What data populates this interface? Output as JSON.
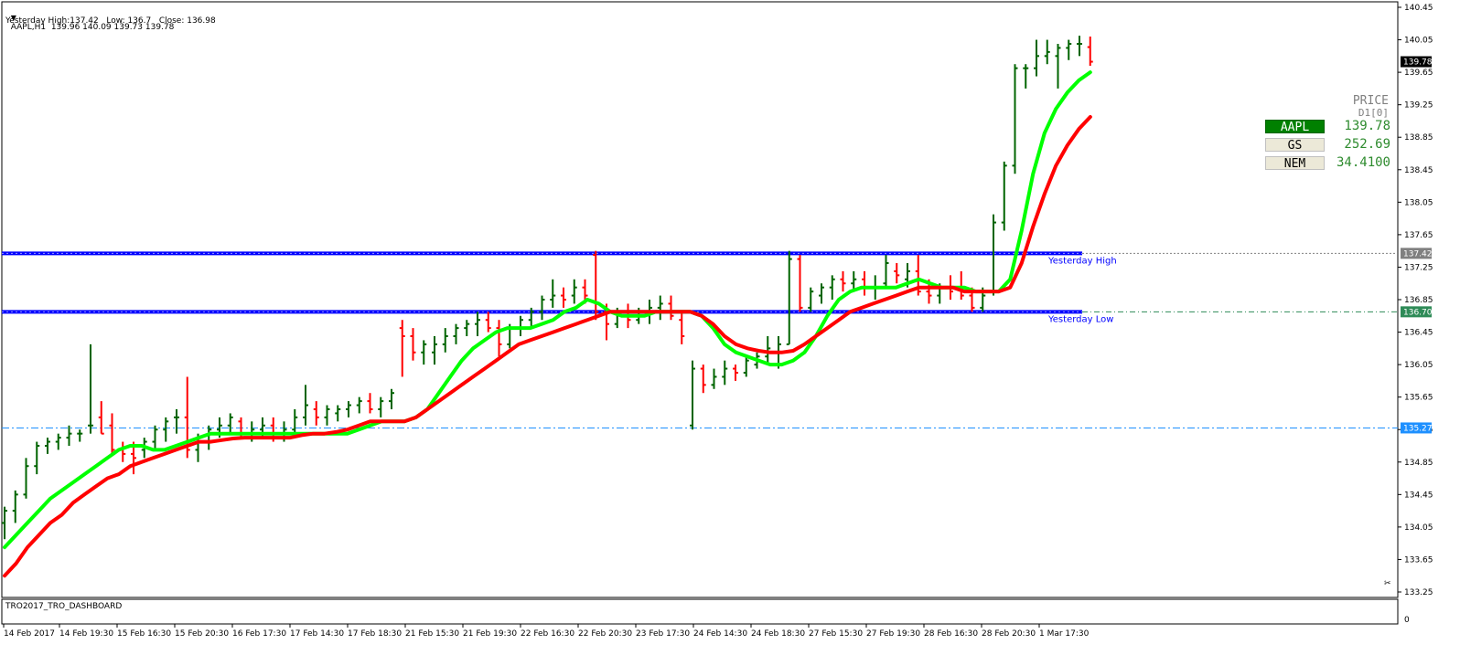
{
  "header": {
    "symbol_line": "AAPL,H1  139.96 140.09 139.73 139.78",
    "yesterday_line": "Yesterday High:137.42   Low: 136.7   Close: 136.98"
  },
  "dashboard": {
    "title": "TRO2017_TRO_DASHBOARD",
    "price_heading": "PRICE",
    "price_sub": "D1[0]",
    "rows": [
      {
        "symbol": "AAPL",
        "value": "139.78",
        "bg": "#008000",
        "fg": "#ffffff",
        "value_color": "#2e8b2e"
      },
      {
        "symbol": "GS",
        "value": "252.69",
        "bg": "#ece9d8",
        "fg": "#000000",
        "value_color": "#2e8b2e"
      },
      {
        "symbol": "NEM",
        "value": "34.4100",
        "bg": "#ece9d8",
        "fg": "#000000",
        "value_color": "#2e8b2e"
      }
    ]
  },
  "colors": {
    "up_bar": "#006400",
    "down_bar": "#ff0000",
    "fast_ma": "#00ff00",
    "slow_ma": "#ff0000",
    "level_line": "#0000ff",
    "close_line": "#1e90ff"
  },
  "chart_data": {
    "type": "line",
    "symbol": "AAPL",
    "timeframe": "H1",
    "ylim": [
      133.25,
      140.45
    ],
    "y_ticks": [
      "140.45",
      "140.05",
      "139.65",
      "139.25",
      "138.85",
      "138.45",
      "138.05",
      "137.65",
      "137.25",
      "136.85",
      "136.45",
      "136.05",
      "135.65",
      "135.25",
      "134.85",
      "134.45",
      "134.05",
      "133.65",
      "133.25"
    ],
    "x_ticks": [
      "14 Feb 2017",
      "14 Feb 19:30",
      "15 Feb 16:30",
      "15 Feb 20:30",
      "16 Feb 17:30",
      "17 Feb 14:30",
      "17 Feb 18:30",
      "21 Feb 15:30",
      "21 Feb 19:30",
      "22 Feb 16:30",
      "22 Feb 20:30",
      "23 Feb 17:30",
      "24 Feb 14:30",
      "24 Feb 18:30",
      "27 Feb 15:30",
      "27 Feb 19:30",
      "28 Feb 16:30",
      "28 Feb 20:30",
      "1 Mar 17:30"
    ],
    "current_price": 139.78,
    "levels": [
      {
        "name": "Yesterday High",
        "value": 137.42
      },
      {
        "name": "Yesterday Low",
        "value": 136.7
      },
      {
        "name": "",
        "value": 135.27
      }
    ],
    "level_tags": [
      "137.42",
      "136.70",
      "135.27",
      "139.78"
    ],
    "bars": [
      [
        134.1,
        134.3,
        133.9,
        134.25
      ],
      [
        134.25,
        134.5,
        134.1,
        134.45
      ],
      [
        134.45,
        134.9,
        134.4,
        134.8
      ],
      [
        134.8,
        135.1,
        134.7,
        135.05
      ],
      [
        135.05,
        135.15,
        134.95,
        135.1
      ],
      [
        135.1,
        135.2,
        135.0,
        135.15
      ],
      [
        135.15,
        135.3,
        135.05,
        135.2
      ],
      [
        135.2,
        135.25,
        135.1,
        135.2
      ],
      [
        135.3,
        136.3,
        135.2,
        135.3
      ],
      [
        135.4,
        135.6,
        135.2,
        135.2
      ],
      [
        135.3,
        135.45,
        134.95,
        135.0
      ],
      [
        135.0,
        135.1,
        134.85,
        134.95
      ],
      [
        134.95,
        135.1,
        134.7,
        134.9
      ],
      [
        135.0,
        135.15,
        134.9,
        135.1
      ],
      [
        135.1,
        135.3,
        135.0,
        135.25
      ],
      [
        135.25,
        135.4,
        135.1,
        135.35
      ],
      [
        135.4,
        135.5,
        135.2,
        135.4
      ],
      [
        135.4,
        135.9,
        134.9,
        135.0
      ],
      [
        135.0,
        135.2,
        134.85,
        135.1
      ],
      [
        135.1,
        135.3,
        135.0,
        135.25
      ],
      [
        135.25,
        135.4,
        135.15,
        135.3
      ],
      [
        135.3,
        135.45,
        135.2,
        135.4
      ],
      [
        135.35,
        135.4,
        135.15,
        135.2
      ],
      [
        135.2,
        135.35,
        135.1,
        135.25
      ],
      [
        135.25,
        135.4,
        135.15,
        135.3
      ],
      [
        135.3,
        135.4,
        135.1,
        135.2
      ],
      [
        135.2,
        135.35,
        135.1,
        135.25
      ],
      [
        135.25,
        135.5,
        135.2,
        135.4
      ],
      [
        135.4,
        135.8,
        135.3,
        135.55
      ],
      [
        135.5,
        135.6,
        135.3,
        135.4
      ],
      [
        135.4,
        135.55,
        135.3,
        135.5
      ],
      [
        135.45,
        135.55,
        135.35,
        135.5
      ],
      [
        135.5,
        135.6,
        135.4,
        135.55
      ],
      [
        135.55,
        135.65,
        135.45,
        135.6
      ],
      [
        135.6,
        135.7,
        135.45,
        135.5
      ],
      [
        135.5,
        135.65,
        135.4,
        135.6
      ],
      [
        135.6,
        135.75,
        135.5,
        135.7
      ],
      [
        136.5,
        136.6,
        135.9,
        136.4
      ],
      [
        136.4,
        136.5,
        136.1,
        136.2
      ],
      [
        136.2,
        136.35,
        136.05,
        136.3
      ],
      [
        136.2,
        136.4,
        136.05,
        136.3
      ],
      [
        136.3,
        136.5,
        136.2,
        136.4
      ],
      [
        136.4,
        136.55,
        136.3,
        136.5
      ],
      [
        136.5,
        136.6,
        136.4,
        136.55
      ],
      [
        136.55,
        136.7,
        136.4,
        136.6
      ],
      [
        136.6,
        136.7,
        136.45,
        136.5
      ],
      [
        136.5,
        136.6,
        136.15,
        136.3
      ],
      [
        136.3,
        136.55,
        136.25,
        136.5
      ],
      [
        136.5,
        136.65,
        136.4,
        136.6
      ],
      [
        136.6,
        136.75,
        136.5,
        136.7
      ],
      [
        136.7,
        136.9,
        136.6,
        136.85
      ],
      [
        136.85,
        137.1,
        136.75,
        136.9
      ],
      [
        136.9,
        137.0,
        136.75,
        136.85
      ],
      [
        136.9,
        137.1,
        136.8,
        137.0
      ],
      [
        137.0,
        137.1,
        136.8,
        136.9
      ],
      [
        137.4,
        137.45,
        136.6,
        136.7
      ],
      [
        136.7,
        136.8,
        136.35,
        136.55
      ],
      [
        136.55,
        136.75,
        136.5,
        136.7
      ],
      [
        136.7,
        136.8,
        136.5,
        136.6
      ],
      [
        136.6,
        136.75,
        136.55,
        136.7
      ],
      [
        136.7,
        136.85,
        136.55,
        136.75
      ],
      [
        136.75,
        136.9,
        136.6,
        136.8
      ],
      [
        136.8,
        136.9,
        136.6,
        136.65
      ],
      [
        136.6,
        136.7,
        136.3,
        136.4
      ],
      [
        135.3,
        136.1,
        135.25,
        136.0
      ],
      [
        136.0,
        136.05,
        135.7,
        135.8
      ],
      [
        135.8,
        136.0,
        135.75,
        135.9
      ],
      [
        135.9,
        136.1,
        135.8,
        136.0
      ],
      [
        136.0,
        136.05,
        135.85,
        135.95
      ],
      [
        135.95,
        136.15,
        135.9,
        136.1
      ],
      [
        136.05,
        136.2,
        136.0,
        136.15
      ],
      [
        136.15,
        136.4,
        136.05,
        136.25
      ],
      [
        136.2,
        136.4,
        136.0,
        136.3
      ],
      [
        136.3,
        137.45,
        136.3,
        137.35
      ],
      [
        137.35,
        137.4,
        136.7,
        136.75
      ],
      [
        136.75,
        137.0,
        136.7,
        136.95
      ],
      [
        136.9,
        137.05,
        136.8,
        137.0
      ],
      [
        137.0,
        137.15,
        136.85,
        137.1
      ],
      [
        137.1,
        137.2,
        136.95,
        137.05
      ],
      [
        137.05,
        137.2,
        136.95,
        137.1
      ],
      [
        137.1,
        137.2,
        136.9,
        137.0
      ],
      [
        137.0,
        137.15,
        136.85,
        137.0
      ],
      [
        137.05,
        137.4,
        137.0,
        137.3
      ],
      [
        137.2,
        137.3,
        137.05,
        137.15
      ],
      [
        137.1,
        137.3,
        137.0,
        137.2
      ],
      [
        137.2,
        137.4,
        136.9,
        136.95
      ],
      [
        136.95,
        137.1,
        136.8,
        136.9
      ],
      [
        136.9,
        137.05,
        136.8,
        137.0
      ],
      [
        137.0,
        137.15,
        136.85,
        136.95
      ],
      [
        137.0,
        137.2,
        136.85,
        136.9
      ],
      [
        136.9,
        137.0,
        136.7,
        136.75
      ],
      [
        136.75,
        137.0,
        136.7,
        136.9
      ],
      [
        136.95,
        137.9,
        136.9,
        137.8
      ],
      [
        137.8,
        138.55,
        137.7,
        138.5
      ],
      [
        138.5,
        139.75,
        138.4,
        139.7
      ],
      [
        139.7,
        139.75,
        139.45,
        139.7
      ],
      [
        139.7,
        140.05,
        139.6,
        139.85
      ],
      [
        139.85,
        140.05,
        139.75,
        139.9
      ],
      [
        139.85,
        140.0,
        139.45,
        139.95
      ],
      [
        139.95,
        140.05,
        139.8,
        140.0
      ],
      [
        140.0,
        140.1,
        139.85,
        140.0
      ],
      [
        139.96,
        140.09,
        139.73,
        139.78
      ]
    ],
    "series": [
      {
        "values": [
          133.8,
          133.95,
          134.1,
          134.25,
          134.4,
          134.5,
          134.6,
          134.7,
          134.8,
          134.9,
          135.0,
          135.05,
          135.05,
          135.0,
          135.0,
          135.05,
          135.1,
          135.15,
          135.2,
          135.2,
          135.2,
          135.2,
          135.2,
          135.2,
          135.2,
          135.2,
          135.2,
          135.2,
          135.2,
          135.2,
          135.2,
          135.25,
          135.3,
          135.35,
          135.35,
          135.35,
          135.4,
          135.5,
          135.7,
          135.9,
          136.1,
          136.25,
          136.35,
          136.45,
          136.5,
          136.5,
          136.5,
          136.55,
          136.6,
          136.7,
          136.75,
          136.85,
          136.8,
          136.7,
          136.65,
          136.65,
          136.65,
          136.7,
          136.7,
          136.7,
          136.7,
          136.65,
          136.5,
          136.3,
          136.2,
          136.15,
          136.1,
          136.05,
          136.05,
          136.1,
          136.2,
          136.4,
          136.65,
          136.85,
          136.95,
          137.0,
          137.0,
          137.0,
          137.0,
          137.05,
          137.1,
          137.05,
          137.0,
          137.0,
          137.0,
          136.95,
          136.95,
          136.95,
          137.1,
          137.7,
          138.4,
          138.9,
          139.2,
          139.4,
          139.55,
          139.65
        ]
      },
      {
        "values": [
          133.45,
          133.6,
          133.8,
          133.95,
          134.1,
          134.2,
          134.35,
          134.45,
          134.55,
          134.65,
          134.7,
          134.8,
          134.85,
          134.9,
          134.95,
          135.0,
          135.05,
          135.1,
          135.1,
          135.12,
          135.14,
          135.15,
          135.15,
          135.15,
          135.15,
          135.15,
          135.18,
          135.2,
          135.2,
          135.22,
          135.25,
          135.3,
          135.35,
          135.35,
          135.35,
          135.35,
          135.4,
          135.5,
          135.6,
          135.7,
          135.8,
          135.9,
          136.0,
          136.1,
          136.2,
          136.3,
          136.35,
          136.4,
          136.45,
          136.5,
          136.55,
          136.6,
          136.65,
          136.7,
          136.7,
          136.7,
          136.7,
          136.7,
          136.7,
          136.7,
          136.7,
          136.65,
          136.55,
          136.4,
          136.3,
          136.25,
          136.22,
          136.2,
          136.2,
          136.22,
          136.3,
          136.4,
          136.5,
          136.6,
          136.7,
          136.75,
          136.8,
          136.85,
          136.9,
          136.95,
          137.0,
          137.0,
          137.0,
          137.0,
          136.95,
          136.95,
          136.95,
          136.95,
          137.0,
          137.3,
          137.75,
          138.15,
          138.5,
          138.75,
          138.95,
          139.1
        ]
      }
    ]
  }
}
